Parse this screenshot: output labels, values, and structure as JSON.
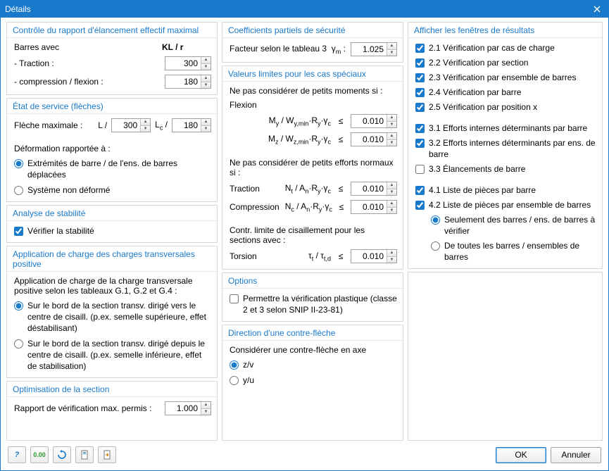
{
  "window": {
    "title": "Détails"
  },
  "col1": {
    "g1": {
      "header": "Contrôle du rapport d'élancement effectif maximal",
      "barres_avec": "Barres avec",
      "klr": "KL / r",
      "traction": "- Traction :",
      "traction_val": "300",
      "compflex": "- compression / flexion :",
      "compflex_val": "180"
    },
    "g2": {
      "header": "État de service (flèches)",
      "fleche": "Flèche maximale :",
      "L": "L /",
      "Lval": "300",
      "Lc": "L",
      "Lcval": "180",
      "deform": "Déformation rapportée à :",
      "r1": "Extrémités de barre / de l'ens. de barres déplacées",
      "r2": "Système non déformé"
    },
    "g3": {
      "header": "Analyse de stabilité",
      "chk": "Vérifier la stabilité"
    },
    "g4": {
      "header": "Application de charge des charges transversales positive",
      "intro": "Application de charge de la charge transversale positive selon les tableaux G.1, G.2 et G.4 :",
      "r1": "Sur le bord de la section transv. dirigé vers le centre de cisaill. (p.ex. semelle supérieure, effet déstabilisant)",
      "r2": "Sur le bord de la section transv. dirigé depuis le centre de cisaill. (p.ex. semelle inférieure, effet de stabilisation)"
    },
    "g5": {
      "header": "Optimisation de la section",
      "label": "Rapport de vérification max. permis :",
      "val": "1.000"
    }
  },
  "col2": {
    "g1": {
      "header": "Coefficients partiels de sécurité",
      "label": "Facteur selon le tableau 3",
      "sym": "γ",
      "val": "1.025"
    },
    "g2": {
      "header": "Valeurs limites pour les cas spéciaux",
      "l1": "Ne pas considérer de petits moments si :",
      "flexion": "Flexion",
      "my": "M",
      "my_val": "0.010",
      "mz": "M",
      "mz_val": "0.010",
      "l2": "Ne pas considérer de petits efforts normaux si :",
      "traction": "Traction",
      "nt_val": "0.010",
      "compression": "Compression",
      "nc_val": "0.010",
      "l3": "Contr. limite de cisaillement pour les sections avec :",
      "torsion": "Torsion",
      "tau_val": "0.010"
    },
    "g3": {
      "header": "Options",
      "chk": "Permettre la vérification plastique (classe 2 et 3 selon SNIP II-23-81)"
    },
    "g4": {
      "header": "Direction d'une contre-flèche",
      "label": "Considérer une contre-flèche en axe",
      "r1": "z/v",
      "r2": "y/u"
    }
  },
  "col3": {
    "header": "Afficher les fenêtres de résultats",
    "c21": "2.1 Vérification par cas de charge",
    "c22": "2.2 Vérification par section",
    "c23": "2.3 Vérification par ensemble de barres",
    "c24": "2.4 Vérification par barre",
    "c25": "2.5 Vérification par position x",
    "c31": "3.1 Efforts internes déterminants par barre",
    "c32": "3.2 Efforts internes déterminants par ens. de barre",
    "c33": "3.3 Élancements de barre",
    "c41": "4.1 Liste de pièces par barre",
    "c42": "4.2 Liste de pièces par ensemble de barres",
    "r1": "Seulement des barres / ens. de barres à vérifier",
    "r2": "De toutes les barres / ensembles de barres"
  },
  "buttons": {
    "ok": "OK",
    "cancel": "Annuler"
  }
}
